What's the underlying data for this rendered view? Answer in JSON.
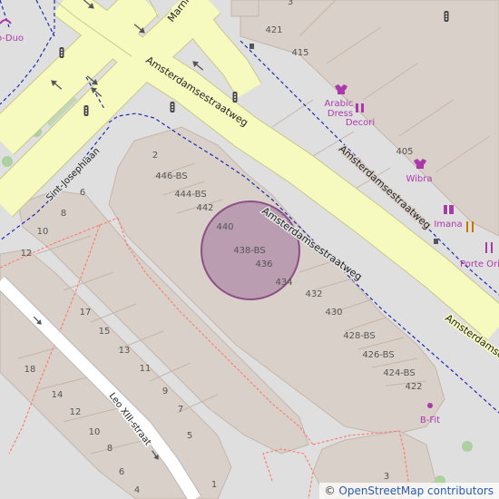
{
  "map": {
    "streets": {
      "main": "Amsterdamsestraatweg",
      "main_side": "Amsterdamsestraatweg",
      "main_right": "Amsterdamsestraatweg",
      "right_service": "Amsterdamsestraatweg",
      "marnix": "Marni",
      "sint_josephlaan": "Sint-Josephlaan",
      "leo": "Leo XIII-straat"
    },
    "house_numbers": [
      "2",
      "446-BS",
      "444-BS",
      "442",
      "440",
      "438-BS",
      "436",
      "434",
      "432",
      "430",
      "428-BS",
      "426-BS",
      "424-BS",
      "422",
      "6",
      "8",
      "10",
      "12",
      "17",
      "15",
      "13",
      "11",
      "9",
      "7",
      "5",
      "1",
      "18",
      "14",
      "12",
      "10",
      "8",
      "6",
      "4",
      "3",
      "421",
      "415",
      "405",
      "3"
    ],
    "pois": {
      "arabic": "Arabic\nDress",
      "decori": "Decori",
      "wibra": "Wibra",
      "imana": "Imana",
      "porte": "Porte Ori",
      "bfit": "B-Fit",
      "duo": "o-Duo"
    },
    "colors": {
      "background": "#e0dfdf",
      "building": "#d9d0c9",
      "building_edge": "#c4b6ab",
      "primary_road": "#f7fabf",
      "primary_casing": "#c8c88a",
      "footway_dash": "#fa8072",
      "bus_dash": "#1e2ab4",
      "poi_magenta": "#ac39ac",
      "poi_food": "#c77400",
      "park": "#add19e",
      "circle_fill": "#a0729a",
      "circle_stroke": "#8c4f86"
    }
  },
  "attribution": {
    "copy": "©",
    "text": "OpenStreetMap contributors"
  }
}
